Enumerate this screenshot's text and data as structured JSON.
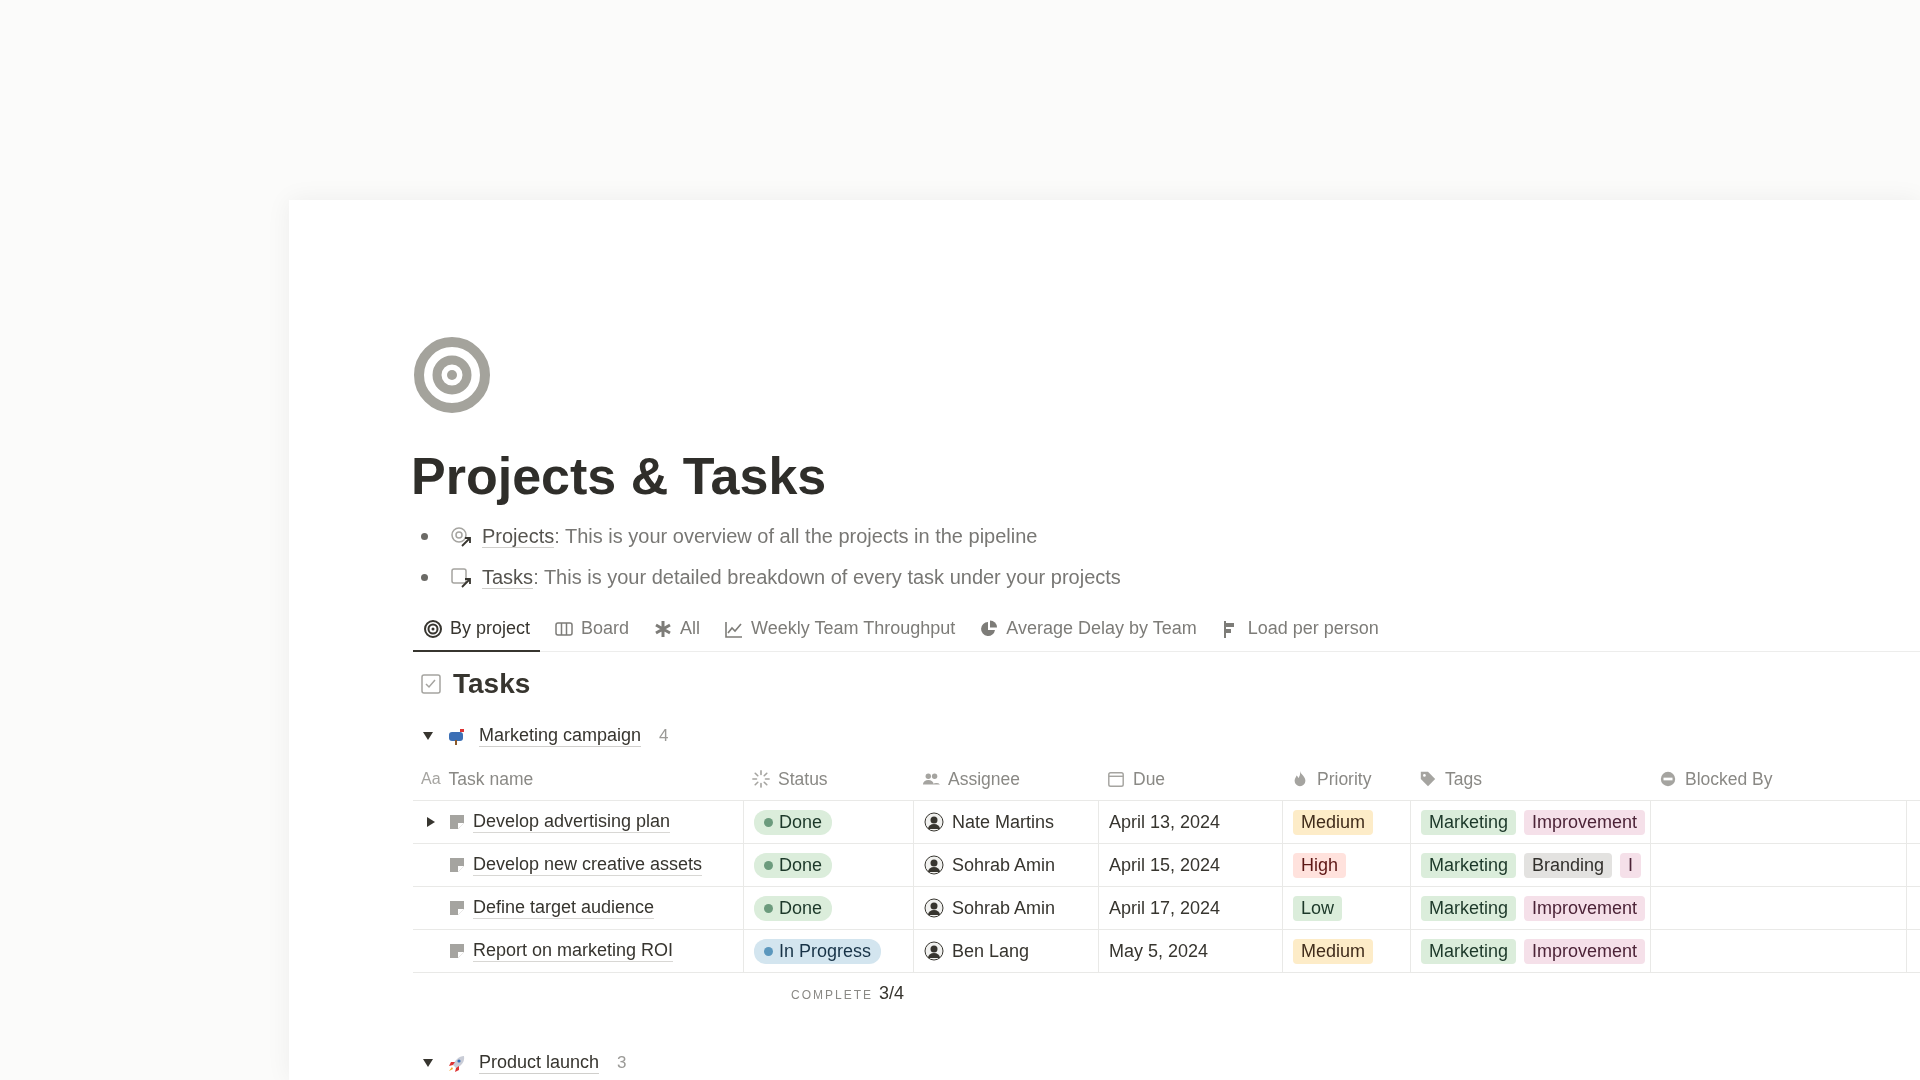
{
  "page": {
    "title": "Projects & Tasks"
  },
  "links": [
    {
      "link": "Projects",
      "text": ": This is your overview of all the projects in the pipeline"
    },
    {
      "link": "Tasks",
      "text": ": This is your detailed breakdown of every task under your projects"
    }
  ],
  "tabs": [
    {
      "label": "By project",
      "selected": true
    },
    {
      "label": "Board",
      "selected": false
    },
    {
      "label": "All",
      "selected": false
    },
    {
      "label": "Weekly Team Throughput",
      "selected": false
    },
    {
      "label": "Average Delay by Team",
      "selected": false
    },
    {
      "label": "Load per person",
      "selected": false
    }
  ],
  "database": {
    "title": "Tasks"
  },
  "groups": [
    {
      "name": "Marketing campaign",
      "count": "4",
      "expanded": true,
      "title_column_mark": "Aa",
      "columns": [
        "Task name",
        "Status",
        "Assignee",
        "Due",
        "Priority",
        "Tags",
        "Blocked By"
      ],
      "rows": [
        {
          "name": "Develop advertising plan",
          "expandable": true,
          "status": {
            "label": "Done",
            "color": "#dbeddb"
          },
          "assignee": "Nate Martins",
          "due": "April 13, 2024",
          "priority": {
            "label": "Medium",
            "color": "#fdecc8"
          },
          "tags": [
            {
              "label": "Marketing",
              "color": "#dbeddb"
            },
            {
              "label": "Improvement",
              "color": "#f5e0e9"
            }
          ]
        },
        {
          "name": "Develop new creative assets",
          "expandable": false,
          "status": {
            "label": "Done",
            "color": "#dbeddb"
          },
          "assignee": "Sohrab Amin",
          "due": "April 15, 2024",
          "priority": {
            "label": "High",
            "color": "#ffe2dd"
          },
          "tags": [
            {
              "label": "Marketing",
              "color": "#dbeddb"
            },
            {
              "label": "Branding",
              "color": "#e3e2e0"
            },
            {
              "label": "I",
              "color": "#f5e0e9"
            }
          ]
        },
        {
          "name": "Define target audience",
          "expandable": false,
          "status": {
            "label": "Done",
            "color": "#dbeddb"
          },
          "assignee": "Sohrab Amin",
          "due": "April 17, 2024",
          "priority": {
            "label": "Low",
            "color": "#dbeddb"
          },
          "tags": [
            {
              "label": "Marketing",
              "color": "#dbeddb"
            },
            {
              "label": "Improvement",
              "color": "#f5e0e9"
            }
          ]
        },
        {
          "name": "Report on marketing ROI",
          "expandable": false,
          "status": {
            "label": "In Progress",
            "color": "#d3e5ef"
          },
          "assignee": "Ben Lang",
          "due": "May 5, 2024",
          "priority": {
            "label": "Medium",
            "color": "#fdecc8"
          },
          "tags": [
            {
              "label": "Marketing",
              "color": "#dbeddb"
            },
            {
              "label": "Improvement",
              "color": "#f5e0e9"
            }
          ]
        }
      ],
      "summary": {
        "label": "COMPLETE",
        "value": "3/4"
      }
    },
    {
      "name": "Product launch",
      "count": "3",
      "expanded": true
    }
  ]
}
